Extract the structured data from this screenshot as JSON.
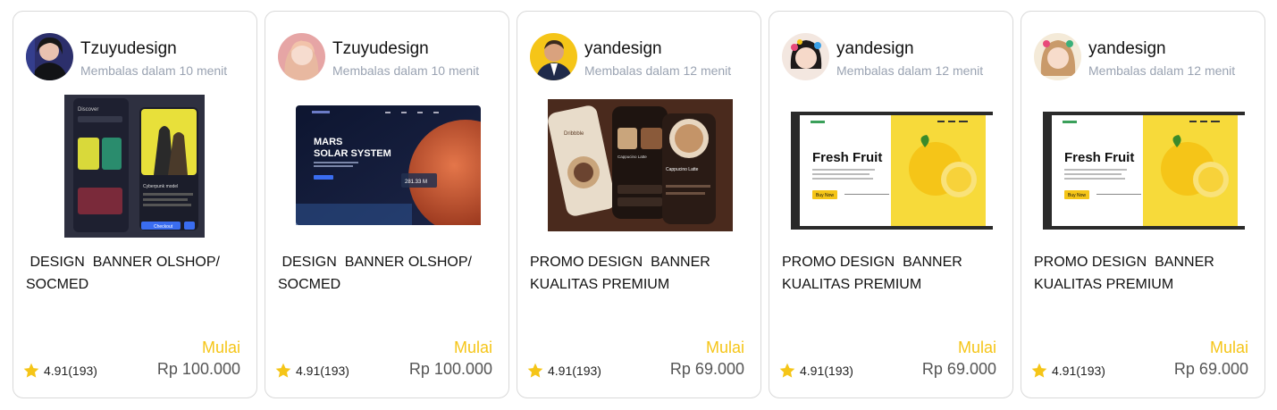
{
  "cards": [
    {
      "seller": "Tzuyudesign",
      "reply": "Membalas dalam 10 menit",
      "title": " DESIGN  BANNER OLSHOP/\nSOCMED",
      "price_prefix": "Mulai",
      "price": "Rp 100.000",
      "rating": "4.91(193)",
      "thumb_screen_title": "Discover",
      "thumb_product": "Cyberpunk model",
      "thumb_cta": "Checkout"
    },
    {
      "seller": "Tzuyudesign",
      "reply": "Membalas dalam 10 menit",
      "title": " DESIGN  BANNER OLSHOP/\nSOCMED",
      "price_prefix": "Mulai",
      "price": "Rp 100.000",
      "rating": "4.91(193)",
      "thumb_headline_1": "MARS",
      "thumb_headline_2": "SOLAR SYSTEM",
      "thumb_stat": "281.33 M"
    },
    {
      "seller": "yandesign",
      "reply": "Membalas dalam 12 menit",
      "title": "PROMO DESIGN  BANNER\nKUALITAS PREMIUM",
      "price_prefix": "Mulai",
      "price": "Rp 69.000",
      "rating": "4.91(193)",
      "thumb_brand": "Dribbble",
      "thumb_item_1": "Cappucino Latte",
      "thumb_item_2": "Cappucino Latte"
    },
    {
      "seller": "yandesign",
      "reply": "Membalas dalam 12 menit",
      "title": "PROMO DESIGN  BANNER\nKUALITAS PREMIUM",
      "price_prefix": "Mulai",
      "price": "Rp 69.000",
      "rating": "4.91(193)",
      "thumb_headline": "Fresh Fruit",
      "thumb_cta": "Buy Now"
    },
    {
      "seller": "yandesign",
      "reply": "Membalas dalam 12 menit",
      "title": "PROMO DESIGN  BANNER\nKUALITAS PREMIUM",
      "price_prefix": "Mulai",
      "price": "Rp 69.000",
      "rating": "4.91(193)",
      "thumb_headline": "Fresh Fruit",
      "thumb_cta": "Buy Now"
    }
  ],
  "colors": {
    "accent_yellow": "#f5c518",
    "muted_text": "#9aa3b2",
    "card_border": "#d9d9d9"
  },
  "icons": {
    "rating": "star-icon"
  }
}
